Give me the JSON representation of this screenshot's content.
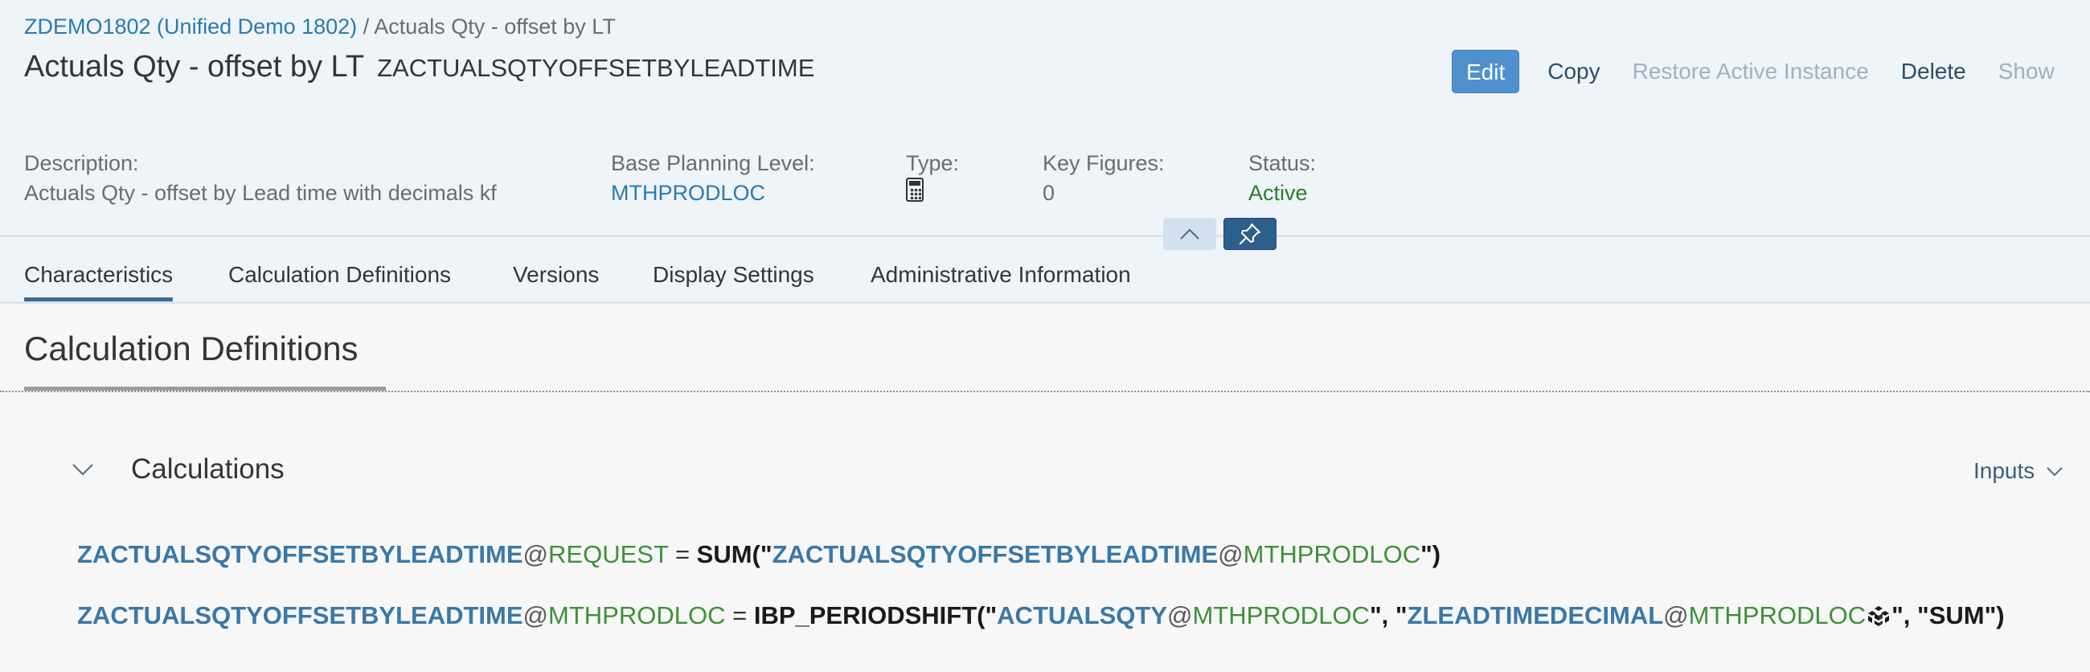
{
  "breadcrumb": {
    "root": "ZDEMO1802 (Unified Demo 1802)",
    "separator": " / ",
    "current": "Actuals Qty - offset by LT"
  },
  "header": {
    "title": "Actuals Qty - offset by LT",
    "code": "ZACTUALSQTYOFFSETBYLEADTIME"
  },
  "actions": {
    "edit": "Edit",
    "copy": "Copy",
    "restore": "Restore Active Instance",
    "delete": "Delete",
    "show": "Show"
  },
  "attributes": {
    "description": {
      "label": "Description:",
      "value": "Actuals Qty - offset by Lead time with decimals kf"
    },
    "base_planning_level": {
      "label": "Base Planning Level:",
      "value": "MTHPRODLOC"
    },
    "type": {
      "label": "Type:",
      "icon": "calculator-icon"
    },
    "key_figures": {
      "label": "Key Figures:",
      "value": "0"
    },
    "status": {
      "label": "Status:",
      "value": "Active",
      "color": "#2b7d2b"
    }
  },
  "tabs": [
    {
      "label": "Characteristics",
      "active": true
    },
    {
      "label": "Calculation Definitions",
      "active": false
    },
    {
      "label": "Versions",
      "active": false
    },
    {
      "label": "Display Settings",
      "active": false
    },
    {
      "label": "Administrative Information",
      "active": false
    }
  ],
  "section": {
    "title": "Calculation Definitions",
    "panel_title": "Calculations",
    "inputs_label": "Inputs"
  },
  "formulas": [
    {
      "target_kf": "ZACTUALSQTYOFFSETBYLEADTIME",
      "target_level": "REQUEST",
      "equals": " = ",
      "function": "SUM(\"",
      "arg1_kf": "ZACTUALSQTYOFFSETBYLEADTIME",
      "arg1_level": "MTHPRODLOC",
      "close": "\")"
    },
    {
      "target_kf": "ZACTUALSQTYOFFSETBYLEADTIME",
      "target_level": "MTHPRODLOC",
      "equals": " = ",
      "function": "IBP_PERIODSHIFT(\"",
      "arg1_kf": "ACTUALSQTY",
      "arg1_level": "MTHPRODLOC",
      "sep1": "\", \"",
      "arg2_kf": "ZLEADTIMEDECIMAL",
      "arg2_level": "MTHPRODLOC",
      "arg2_icon": "cube-icon",
      "tail": "\", \"SUM\")"
    }
  ],
  "colors": {
    "accent": "#4f91cd",
    "key_figure": "#3a78a8",
    "planning_level": "#3f8f3a",
    "status_active": "#2b7d2b",
    "header_bg": "#eff4f9"
  }
}
